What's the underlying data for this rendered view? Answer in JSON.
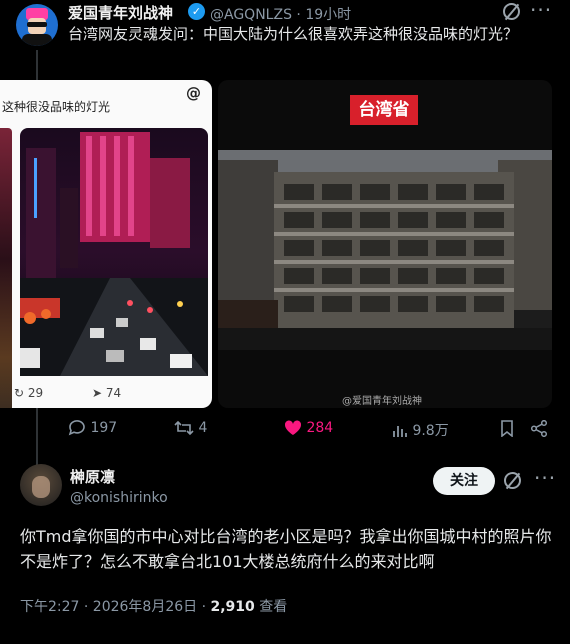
{
  "post1": {
    "author_name": "爱国青年刘战神",
    "handle": "@AGQNLZS",
    "time": "19小时",
    "text": "台湾网友灵魂发问：中国大陆为什么很喜欢弄这种很没品味的灯光？",
    "icons": {
      "verified": "verified-badge-icon",
      "grok": "grok-icon",
      "more": "more-icon"
    }
  },
  "media_left": {
    "caption": "这种很没品味的灯光",
    "threads_logo": "@",
    "repost_count": "29",
    "share_count": "74"
  },
  "media_right": {
    "label": "台湾省",
    "watermark": "@爱国青年刘战神"
  },
  "actions": {
    "replies": "197",
    "reposts": "4",
    "likes": "284",
    "views": "9.8万",
    "accent_like": "#f91880"
  },
  "post2": {
    "author_name": "榊原凛",
    "handle": "@konishirinko",
    "follow_label": "关注",
    "text": "你Tmd拿你国的市中心对比台湾的老小区是吗？我拿出你国城中村的照片你不是炸了？怎么不敢拿台北101大楼总统府什么的来对比啊",
    "time": "下午2:27 · 2026年8月26日 · ",
    "views_count": "2,910",
    "views_label": " 查看"
  }
}
